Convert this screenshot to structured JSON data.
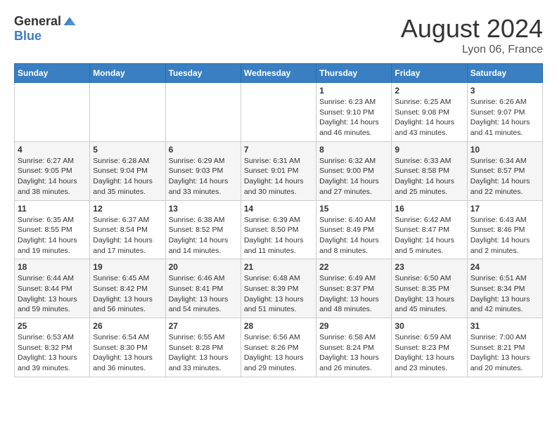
{
  "header": {
    "logo_general": "General",
    "logo_blue": "Blue",
    "title": "August 2024",
    "location": "Lyon 06, France"
  },
  "days_of_week": [
    "Sunday",
    "Monday",
    "Tuesday",
    "Wednesday",
    "Thursday",
    "Friday",
    "Saturday"
  ],
  "weeks": [
    [
      {
        "day": "",
        "info": ""
      },
      {
        "day": "",
        "info": ""
      },
      {
        "day": "",
        "info": ""
      },
      {
        "day": "",
        "info": ""
      },
      {
        "day": "1",
        "info": "Sunrise: 6:23 AM\nSunset: 9:10 PM\nDaylight: 14 hours and 46 minutes."
      },
      {
        "day": "2",
        "info": "Sunrise: 6:25 AM\nSunset: 9:08 PM\nDaylight: 14 hours and 43 minutes."
      },
      {
        "day": "3",
        "info": "Sunrise: 6:26 AM\nSunset: 9:07 PM\nDaylight: 14 hours and 41 minutes."
      }
    ],
    [
      {
        "day": "4",
        "info": "Sunrise: 6:27 AM\nSunset: 9:05 PM\nDaylight: 14 hours and 38 minutes."
      },
      {
        "day": "5",
        "info": "Sunrise: 6:28 AM\nSunset: 9:04 PM\nDaylight: 14 hours and 35 minutes."
      },
      {
        "day": "6",
        "info": "Sunrise: 6:29 AM\nSunset: 9:03 PM\nDaylight: 14 hours and 33 minutes."
      },
      {
        "day": "7",
        "info": "Sunrise: 6:31 AM\nSunset: 9:01 PM\nDaylight: 14 hours and 30 minutes."
      },
      {
        "day": "8",
        "info": "Sunrise: 6:32 AM\nSunset: 9:00 PM\nDaylight: 14 hours and 27 minutes."
      },
      {
        "day": "9",
        "info": "Sunrise: 6:33 AM\nSunset: 8:58 PM\nDaylight: 14 hours and 25 minutes."
      },
      {
        "day": "10",
        "info": "Sunrise: 6:34 AM\nSunset: 8:57 PM\nDaylight: 14 hours and 22 minutes."
      }
    ],
    [
      {
        "day": "11",
        "info": "Sunrise: 6:35 AM\nSunset: 8:55 PM\nDaylight: 14 hours and 19 minutes."
      },
      {
        "day": "12",
        "info": "Sunrise: 6:37 AM\nSunset: 8:54 PM\nDaylight: 14 hours and 17 minutes."
      },
      {
        "day": "13",
        "info": "Sunrise: 6:38 AM\nSunset: 8:52 PM\nDaylight: 14 hours and 14 minutes."
      },
      {
        "day": "14",
        "info": "Sunrise: 6:39 AM\nSunset: 8:50 PM\nDaylight: 14 hours and 11 minutes."
      },
      {
        "day": "15",
        "info": "Sunrise: 6:40 AM\nSunset: 8:49 PM\nDaylight: 14 hours and 8 minutes."
      },
      {
        "day": "16",
        "info": "Sunrise: 6:42 AM\nSunset: 8:47 PM\nDaylight: 14 hours and 5 minutes."
      },
      {
        "day": "17",
        "info": "Sunrise: 6:43 AM\nSunset: 8:46 PM\nDaylight: 14 hours and 2 minutes."
      }
    ],
    [
      {
        "day": "18",
        "info": "Sunrise: 6:44 AM\nSunset: 8:44 PM\nDaylight: 13 hours and 59 minutes."
      },
      {
        "day": "19",
        "info": "Sunrise: 6:45 AM\nSunset: 8:42 PM\nDaylight: 13 hours and 56 minutes."
      },
      {
        "day": "20",
        "info": "Sunrise: 6:46 AM\nSunset: 8:41 PM\nDaylight: 13 hours and 54 minutes."
      },
      {
        "day": "21",
        "info": "Sunrise: 6:48 AM\nSunset: 8:39 PM\nDaylight: 13 hours and 51 minutes."
      },
      {
        "day": "22",
        "info": "Sunrise: 6:49 AM\nSunset: 8:37 PM\nDaylight: 13 hours and 48 minutes."
      },
      {
        "day": "23",
        "info": "Sunrise: 6:50 AM\nSunset: 8:35 PM\nDaylight: 13 hours and 45 minutes."
      },
      {
        "day": "24",
        "info": "Sunrise: 6:51 AM\nSunset: 8:34 PM\nDaylight: 13 hours and 42 minutes."
      }
    ],
    [
      {
        "day": "25",
        "info": "Sunrise: 6:53 AM\nSunset: 8:32 PM\nDaylight: 13 hours and 39 minutes."
      },
      {
        "day": "26",
        "info": "Sunrise: 6:54 AM\nSunset: 8:30 PM\nDaylight: 13 hours and 36 minutes."
      },
      {
        "day": "27",
        "info": "Sunrise: 6:55 AM\nSunset: 8:28 PM\nDaylight: 13 hours and 33 minutes."
      },
      {
        "day": "28",
        "info": "Sunrise: 6:56 AM\nSunset: 8:26 PM\nDaylight: 13 hours and 29 minutes."
      },
      {
        "day": "29",
        "info": "Sunrise: 6:58 AM\nSunset: 8:24 PM\nDaylight: 13 hours and 26 minutes."
      },
      {
        "day": "30",
        "info": "Sunrise: 6:59 AM\nSunset: 8:23 PM\nDaylight: 13 hours and 23 minutes."
      },
      {
        "day": "31",
        "info": "Sunrise: 7:00 AM\nSunset: 8:21 PM\nDaylight: 13 hours and 20 minutes."
      }
    ]
  ]
}
